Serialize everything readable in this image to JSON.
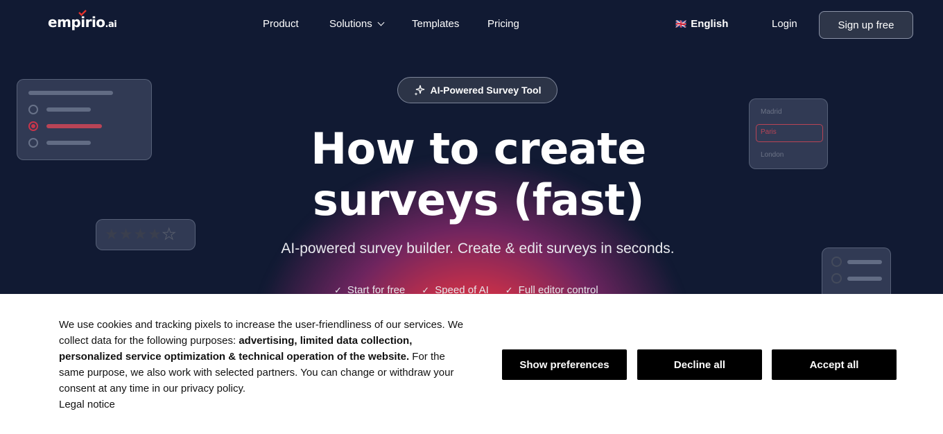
{
  "nav": {
    "logo_text": "empirio",
    "logo_suffix": ".ai",
    "links": [
      "Product",
      "Solutions",
      "Templates",
      "Pricing"
    ],
    "language_flag": "🇬🇧",
    "language": "English",
    "login": "Login",
    "signup": "Sign up free"
  },
  "hero": {
    "badge": "AI-Powered Survey Tool",
    "headline_line1": "How to create",
    "headline_line2": "surveys (fast)",
    "subline": "AI-powered survey builder. Create & edit surveys in seconds.",
    "checks": [
      "Start for free",
      "Speed of AI",
      "Full editor control"
    ]
  },
  "deco": {
    "city_options": [
      "Madrid",
      "Paris",
      "London"
    ],
    "rating_filled": 4,
    "rating_max": 5
  },
  "cookie": {
    "text_a": "We use cookies and tracking pixels to increase the user-friendliness of our services. We collect data for the following purposes: ",
    "text_bold": "advertising, limited data collection, personalized service optimization & technical operation of the website.",
    "text_b": " For the same purpose, we also work with selected partners. You can change or withdraw your consent at any time in our privacy policy.",
    "legal": "Legal notice",
    "buttons": {
      "preferences": "Show preferences",
      "decline": "Decline all",
      "accept": "Accept all"
    }
  },
  "colors": {
    "background": "#111a33",
    "glow": "#e4312b",
    "accent": "#e4312b",
    "button": "#000000"
  }
}
